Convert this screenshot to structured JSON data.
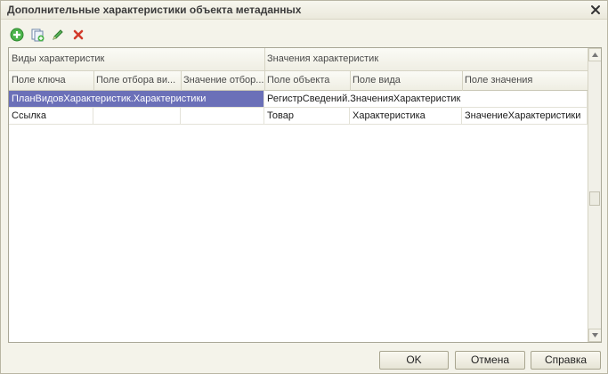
{
  "window": {
    "title": "Дополнительные характеристики объекта метаданных",
    "close_icon": "close-icon"
  },
  "toolbar": {
    "items": [
      {
        "icon": "add-icon",
        "color": "#3aa33a"
      },
      {
        "icon": "copy-icon",
        "color": "#4a7cc9"
      },
      {
        "icon": "edit-icon",
        "color": "#2f8f2f"
      },
      {
        "icon": "delete-icon",
        "color": "#d23a2a"
      }
    ]
  },
  "table": {
    "groups": [
      "Виды характеристик",
      "Значения характеристик"
    ],
    "columns": [
      "Поле ключа",
      "Поле отбора ви...",
      "Значение отбор...",
      "Поле объекта",
      "Поле вида",
      "Поле значения"
    ],
    "rows": [
      {
        "kinds_merged": "ПланВидовХарактеристик.Характеристики",
        "object_field": "РегистрСведений.ЗначенияХарактеристик",
        "kind_field": "",
        "value_field": ""
      },
      {
        "key_field": "Ссылка",
        "filter_field": "",
        "filter_value": "",
        "object_field": "Товар",
        "kind_field": "Характеристика",
        "value_field": "ЗначениеХарактеристики"
      }
    ],
    "selection_color": "#6b70b8"
  },
  "buttons": {
    "ok": "OK",
    "cancel": "Отмена",
    "help": "Справка"
  }
}
